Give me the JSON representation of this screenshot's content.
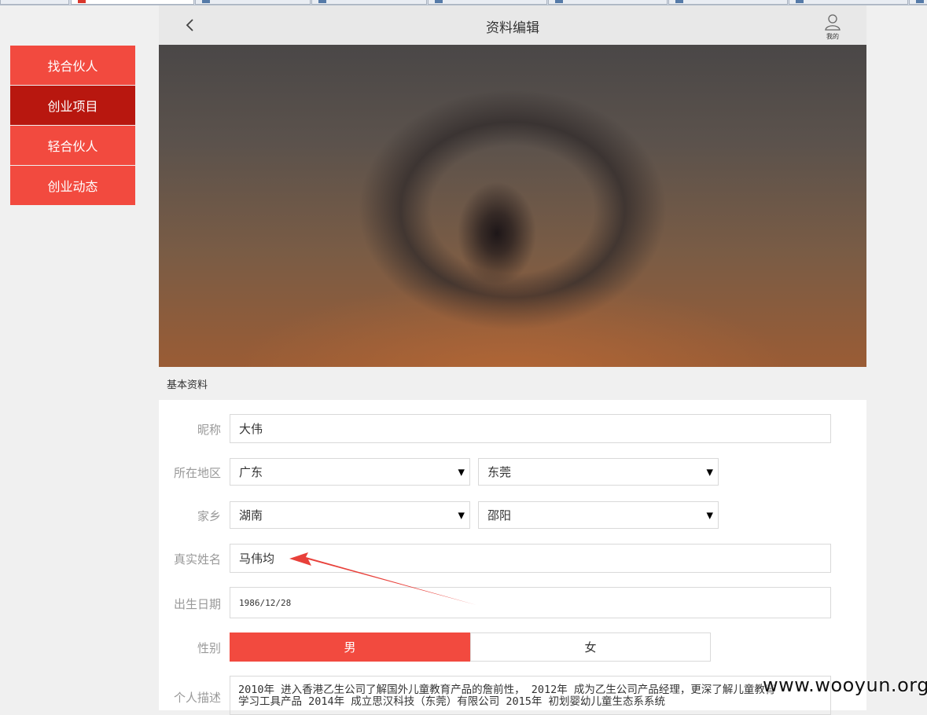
{
  "menu": {
    "items": [
      {
        "label": "找合伙人",
        "active": false
      },
      {
        "label": "创业项目",
        "active": true
      },
      {
        "label": "轻合伙人",
        "active": false
      },
      {
        "label": "创业动态",
        "active": false
      }
    ]
  },
  "header": {
    "title": "资料编辑",
    "me_label": "我的",
    "back_icon": "chevron-left-icon",
    "me_icon": "user-icon"
  },
  "section": {
    "title": "基本资料"
  },
  "form": {
    "nickname": {
      "label": "昵称",
      "value": "大伟"
    },
    "location": {
      "label": "所在地区",
      "province": "广东",
      "city": "东莞"
    },
    "hometown": {
      "label": "家乡",
      "province": "湖南",
      "city": "邵阳"
    },
    "real_name": {
      "label": "真实姓名",
      "value": "马伟均"
    },
    "birthday": {
      "label": "出生日期",
      "value": "1986/12/28"
    },
    "gender": {
      "label": "性别",
      "male": "男",
      "female": "女",
      "selected": "男"
    },
    "description": {
      "label": "个人描述",
      "line1": "2010年 进入香港乙生公司了解国外儿童教育产品的詹前性， 2012年 成为乙生公司产品经理，更深了解儿童教育",
      "line2": "学习工具产品 2014年 成立思汉科技（东莞）有限公司 2015年 初划婴幼儿童生态系系统"
    }
  },
  "colors": {
    "accent": "#f24a3f",
    "accent_dark": "#b8170f",
    "annotation": "#e8403a"
  },
  "watermark": "www.wooyun.org"
}
